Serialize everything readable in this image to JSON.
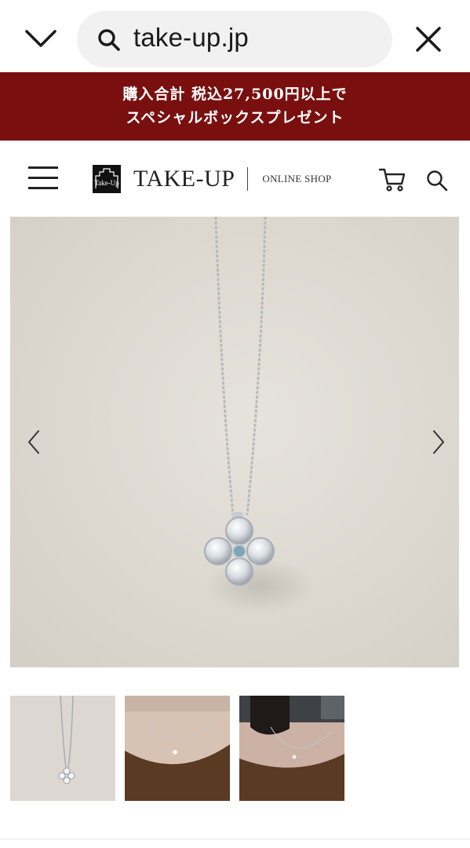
{
  "browser": {
    "url": "take-up.jp",
    "collapse_icon": "chevron-down-icon",
    "search_icon": "search-icon",
    "close_icon": "close-icon"
  },
  "promo": {
    "line1": "購入合計 税込27,500円以上で",
    "line2": "スペシャルボックスプレゼント",
    "background": "#7a0f0f"
  },
  "header": {
    "menu_icon": "hamburger-menu-icon",
    "logo_text": "TAKE-UP",
    "logo_sub": "ONLINE SHOP",
    "cart_icon": "cart-icon",
    "search_icon": "search-icon"
  },
  "gallery": {
    "main_image": "clover-diamond-pendant-necklace",
    "prev_icon": "chevron-left-icon",
    "next_icon": "chevron-right-icon",
    "thumbnails": [
      {
        "image": "pendant-on-background"
      },
      {
        "image": "pendant-worn-front"
      },
      {
        "image": "pendant-worn-side"
      }
    ]
  }
}
